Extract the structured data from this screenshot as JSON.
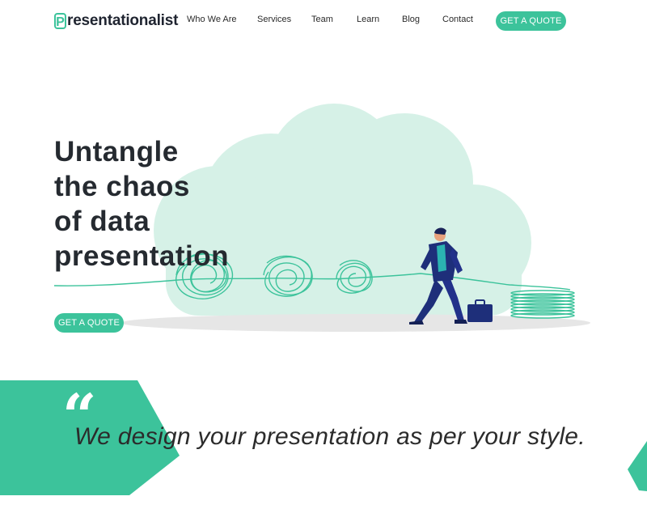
{
  "header": {
    "logo_letter": "P",
    "logo_text": "resentationalist",
    "nav": [
      "Who We Are",
      "Services",
      "Team",
      "Learn",
      "Blog",
      "Contact"
    ],
    "cta_label": "GET A QUOTE"
  },
  "hero": {
    "title_lines": [
      "Untangle",
      "the chaos",
      "of data",
      "presentation"
    ],
    "cta_label": "GET A QUOTE"
  },
  "quote": {
    "mark": "“",
    "text": "We design your presentation as per your style."
  },
  "colors": {
    "accent": "#3cc39b",
    "cloud": "#d6f1e7",
    "suit": "#1e2f7a",
    "shirt": "#2bb3b1",
    "heading": "#252a30"
  }
}
